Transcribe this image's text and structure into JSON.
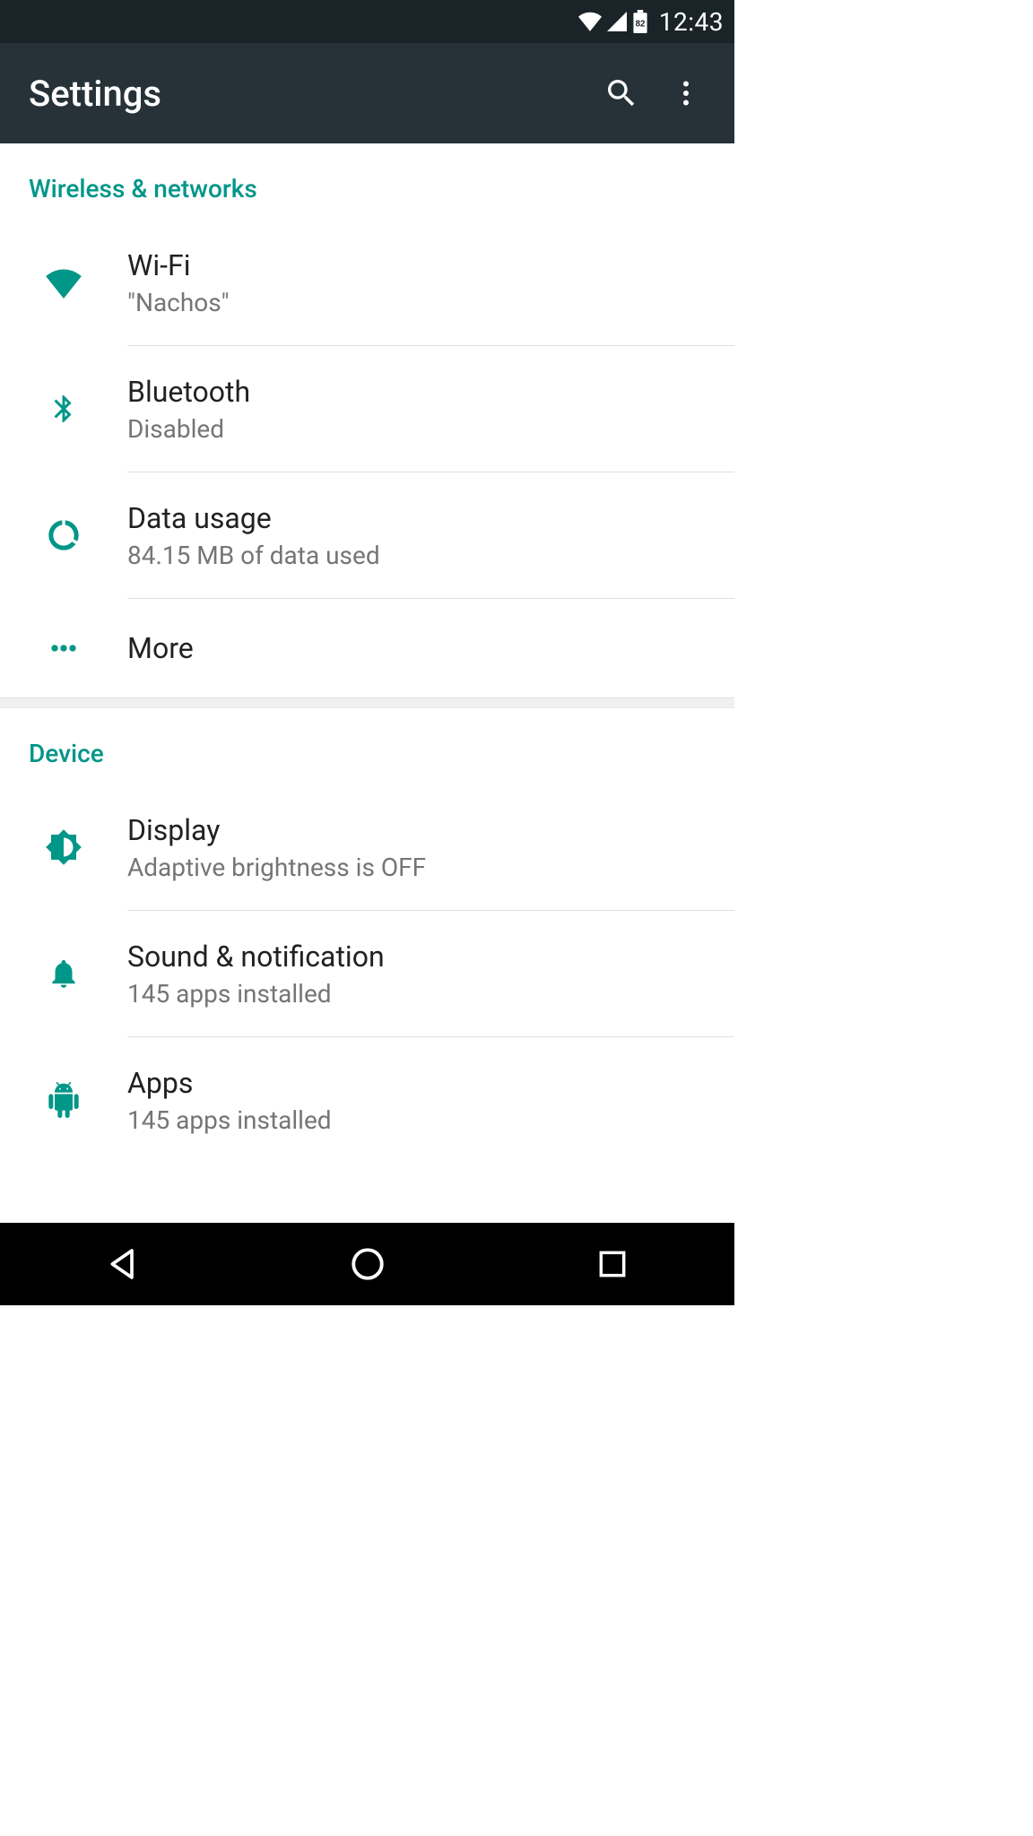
{
  "status": {
    "time": "12:43",
    "battery_pct": "82"
  },
  "appbar": {
    "title": "Settings"
  },
  "sections": {
    "wireless": {
      "header": "Wireless & networks",
      "wifi": {
        "title": "Wi-Fi",
        "sub": "\"Nachos\""
      },
      "bluetooth": {
        "title": "Bluetooth",
        "sub": "Disabled"
      },
      "datausage": {
        "title": "Data usage",
        "sub": "84.15 MB of data used"
      },
      "more": {
        "title": "More"
      }
    },
    "device": {
      "header": "Device",
      "display": {
        "title": "Display",
        "sub": "Adaptive brightness is OFF"
      },
      "sound": {
        "title": "Sound & notification",
        "sub": "145 apps installed"
      },
      "apps": {
        "title": "Apps",
        "sub": "145 apps installed"
      }
    }
  },
  "colors": {
    "accent": "#009688",
    "appbar_bg": "#263238",
    "status_bg": "#1a2428",
    "text_primary": "#212121",
    "text_secondary": "#757575"
  }
}
